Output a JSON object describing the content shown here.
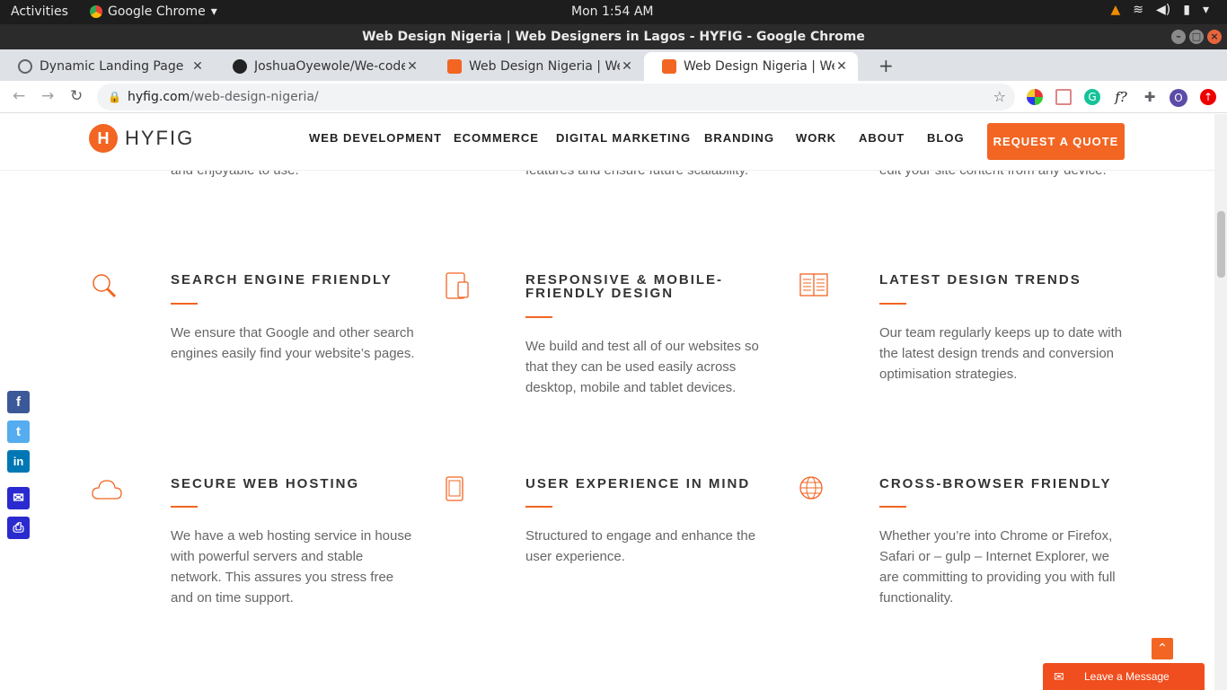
{
  "system_bar": {
    "activities": "Activities",
    "app_name": "Google Chrome",
    "clock": "Mon  1:54 AM"
  },
  "window": {
    "title": "Web Design Nigeria | Web Designers in Lagos - HYFIG - Google Chrome"
  },
  "tabs": [
    {
      "title": "Dynamic Landing Page",
      "icon": "globe-icon"
    },
    {
      "title": "JoshuaOyewole/We-code",
      "icon": "github-icon"
    },
    {
      "title": "Web Design Nigeria | Web",
      "icon": "hyfig-icon"
    },
    {
      "title": "Web Design Nigeria | Web",
      "icon": "hyfig-icon",
      "active": true
    }
  ],
  "address_bar": {
    "domain": "hyfig.com",
    "path": "/web-design-nigeria/"
  },
  "site": {
    "logo_mark": "H",
    "logo_text": "HYFIG",
    "nav": [
      "WEB DEVELOPMENT",
      "ECOMMERCE",
      "DIGITAL MARKETING",
      "BRANDING",
      "WORK",
      "ABOUT",
      "BLOG"
    ],
    "cta": "REQUEST A QUOTE",
    "accent": "#f26522"
  },
  "cut_text": [
    "and enjoyable to use.",
    "features and ensure future scalability.",
    "edit your site content from any device."
  ],
  "features": [
    {
      "title": "SEARCH ENGINE FRIENDLY",
      "body": "We ensure that Google and other search engines easily find your website’s pages.",
      "icon": "magnifier-icon"
    },
    {
      "title": "RESPONSIVE & MOBILE-FRIENDLY DESIGN",
      "body": "We build and test all of our websites so that they can be used easily across desktop, mobile and tablet devices.",
      "icon": "devices-icon"
    },
    {
      "title": "LATEST DESIGN TRENDS",
      "body": "Our team regularly keeps up to date with the latest design trends and conversion optimisation strategies.",
      "icon": "book-icon"
    },
    {
      "title": "SECURE WEB HOSTING",
      "body": "We have a web hosting service in house with powerful servers and stable network. This assures you stress free and on time support.",
      "icon": "cloud-icon"
    },
    {
      "title": "USER EXPERIENCE IN MIND",
      "body": "Structured to engage and enhance the user experience.",
      "icon": "tablet-icon"
    },
    {
      "title": "CROSS-BROWSER FRIENDLY",
      "body": "Whether you’re into Chrome or Firefox, Safari or – gulp – Internet Explorer, we are committing to providing you with full functionality.",
      "icon": "globe-icon"
    }
  ],
  "share_bar": [
    {
      "name": "facebook",
      "glyph": "f",
      "color": "#3b5998"
    },
    {
      "name": "twitter",
      "glyph": "t",
      "color": "#55acee"
    },
    {
      "name": "linkedin",
      "glyph": "in",
      "color": "#0077b5"
    },
    {
      "name": "email",
      "glyph": "✉",
      "color": "#2a2ad0"
    },
    {
      "name": "print",
      "glyph": "⎙",
      "color": "#2a2ad0"
    }
  ],
  "chat": {
    "label": "Leave a Message"
  }
}
